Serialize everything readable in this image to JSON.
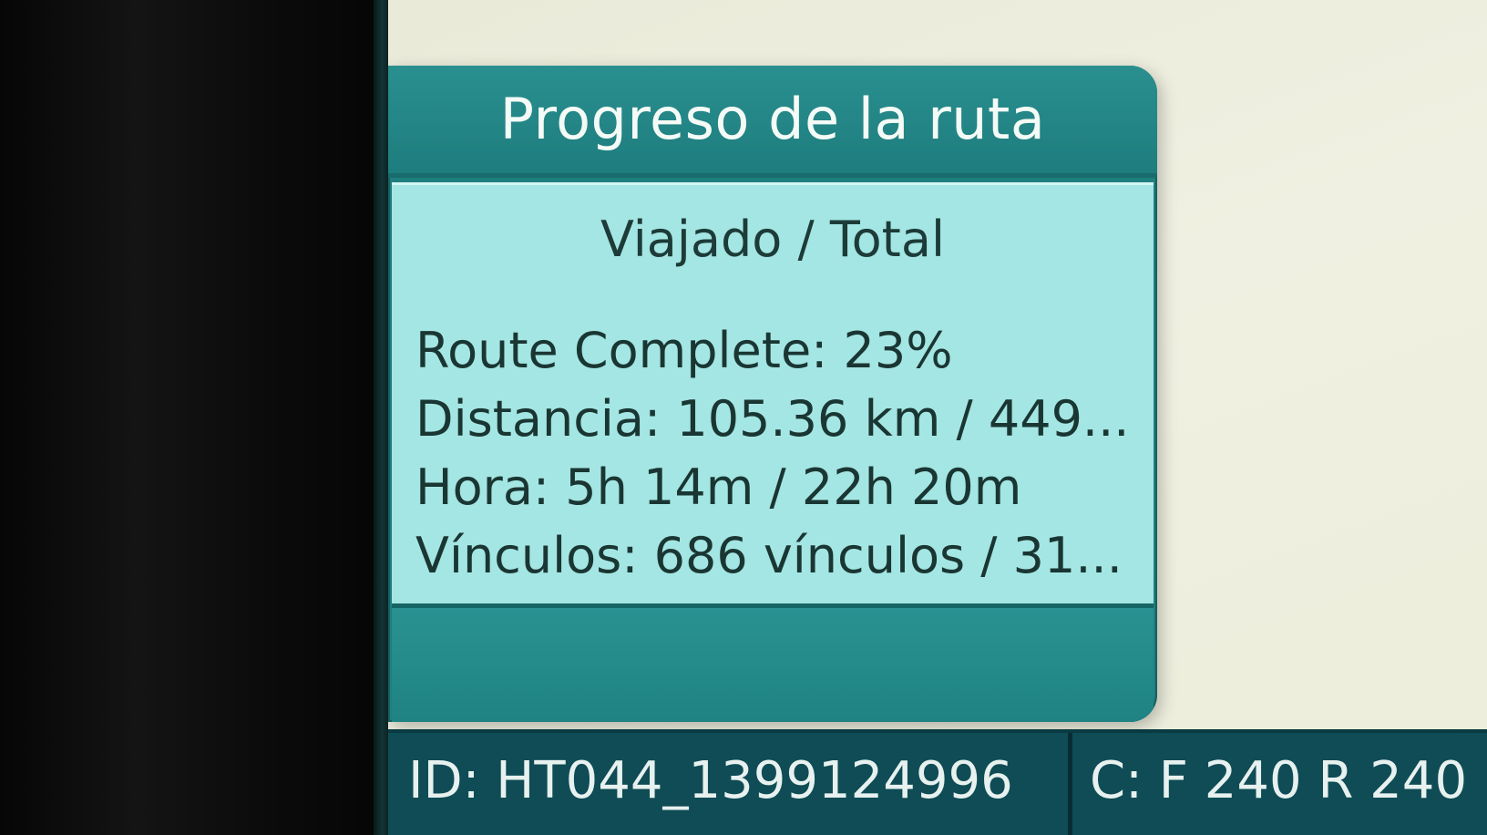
{
  "dialog": {
    "title": "Progreso de la ruta",
    "subheading": "Viajado / Total",
    "rows": [
      {
        "text": "Route Complete: 23%"
      },
      {
        "text": "Distancia: 105.36 km / 449..."
      },
      {
        "text": "Hora: 5h 14m / 22h 20m"
      },
      {
        "text": "Vínculos: 686 vínculos / 31..."
      }
    ]
  },
  "statusbar": {
    "id": "ID: HT044_1399124996",
    "c": "C: F 240 R 240"
  },
  "colors": {
    "header": "#1e7d7e",
    "body": "#a4e6e3",
    "statusbar": "#0f4c55"
  }
}
